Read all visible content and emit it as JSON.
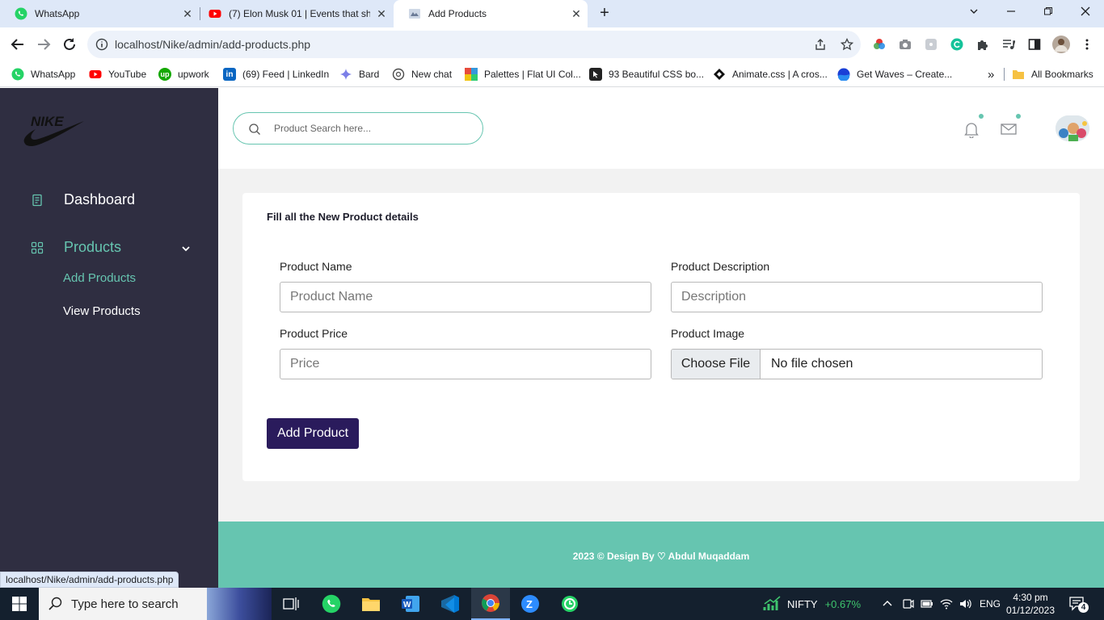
{
  "browser": {
    "tabs": [
      {
        "title": "WhatsApp",
        "icon": "whatsapp-icon"
      },
      {
        "title": "(7) Elon Musk 01 | Events that sh",
        "icon": "youtube-icon"
      },
      {
        "title": "Add Products",
        "icon": "page-icon",
        "active": true
      }
    ],
    "url": "localhost/Nike/admin/add-products.php",
    "bookmarks": [
      {
        "label": "WhatsApp",
        "icon": "whatsapp-icon"
      },
      {
        "label": "YouTube",
        "icon": "youtube-icon"
      },
      {
        "label": "upwork",
        "icon": "upwork-icon"
      },
      {
        "label": "(69) Feed | LinkedIn",
        "icon": "linkedin-icon"
      },
      {
        "label": "Bard",
        "icon": "bard-icon"
      },
      {
        "label": "New chat",
        "icon": "chatgpt-icon"
      },
      {
        "label": "Palettes | Flat UI Col...",
        "icon": "palette-icon"
      },
      {
        "label": "93 Beautiful CSS bo...",
        "icon": "css-icon"
      },
      {
        "label": "Animate.css | A cros...",
        "icon": "animate-icon"
      },
      {
        "label": "Get Waves – Create...",
        "icon": "waves-icon"
      }
    ],
    "more_bookmarks": "»",
    "all_bookmarks": "All Bookmarks",
    "status_url": "localhost/Nike/admin/add-products.php"
  },
  "sidebar": {
    "brand": "nike-swoosh-logo",
    "items": [
      {
        "label": "Dashboard",
        "icon": "dashboard-icon"
      },
      {
        "label": "Products",
        "icon": "grid-icon",
        "expanded": true
      }
    ],
    "subitems": [
      {
        "label": "Add Products",
        "active": true
      },
      {
        "label": "View Products"
      }
    ]
  },
  "header": {
    "search_placeholder": "Product Search here..."
  },
  "form": {
    "title": "Fill all the New Product details",
    "name_label": "Product Name",
    "name_placeholder": "Product Name",
    "description_label": "Product Description",
    "description_placeholder": "Description",
    "price_label": "Product Price",
    "price_placeholder": "Price",
    "image_label": "Product Image",
    "choose_file": "Choose File",
    "no_file": "No file chosen",
    "submit": "Add Product"
  },
  "footer": {
    "text": "2023 © Design By ♡ Abdul Muqaddam"
  },
  "taskbar": {
    "search_text": "Type here to search",
    "nifty_label": "NIFTY",
    "nifty_change": "+0.67%",
    "language": "ENG",
    "time": "4:30 pm",
    "date": "01/12/2023",
    "notification_count": "4"
  },
  "colors": {
    "sidebar_bg": "#2f2e41",
    "accent": "#66c5b0",
    "button_bg": "#2a1b5c",
    "content_bg": "#f2f2f2"
  }
}
